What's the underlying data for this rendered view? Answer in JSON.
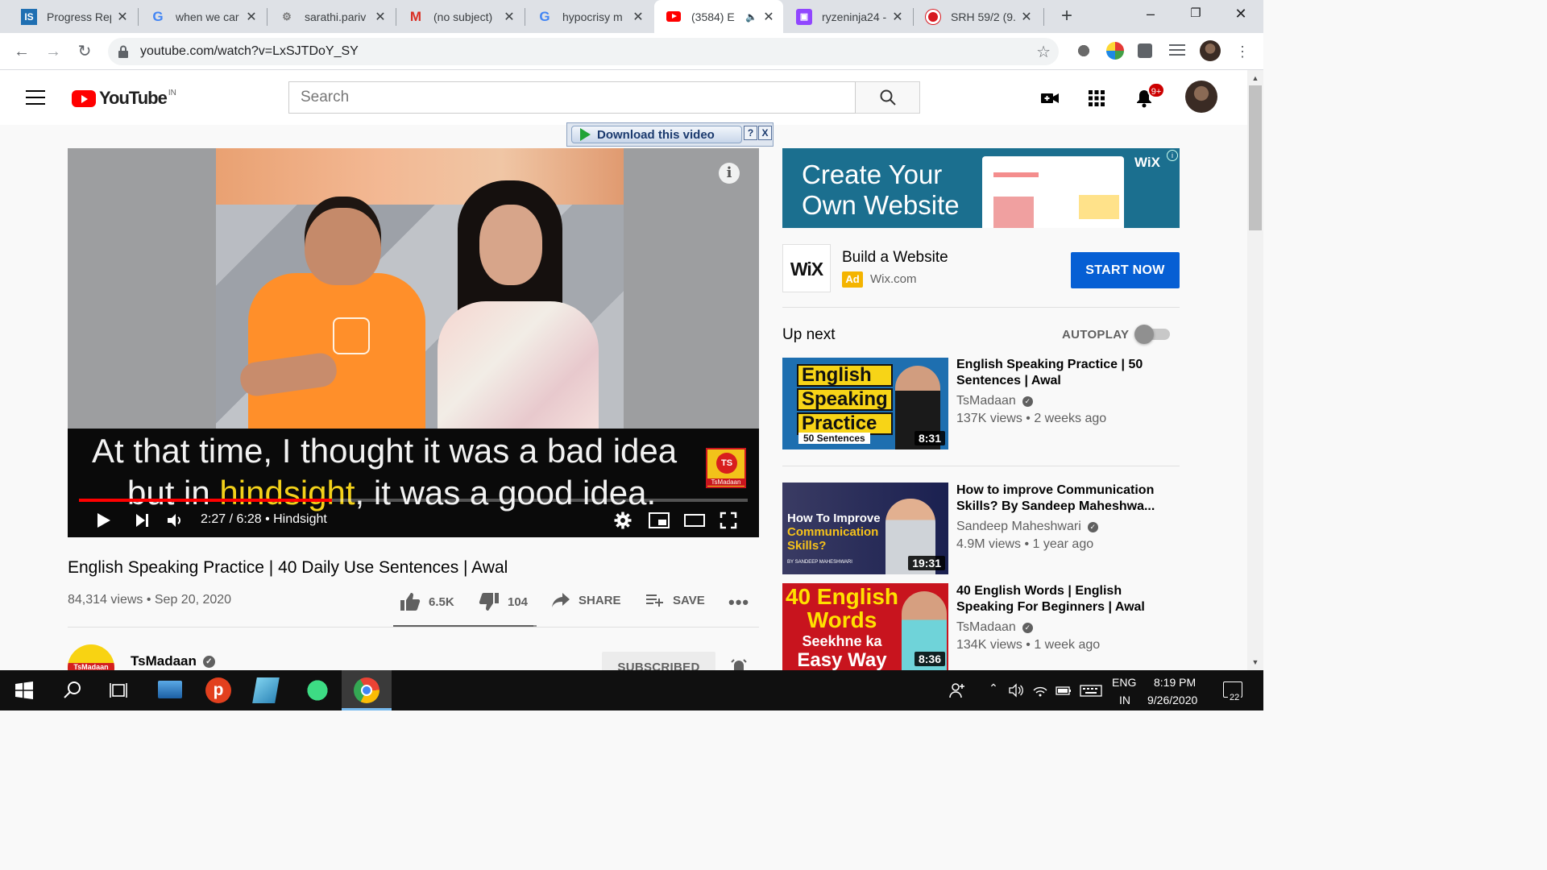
{
  "browser": {
    "tabs": [
      {
        "title": "Progress Rep",
        "icon": "is-icon",
        "active": false
      },
      {
        "title": "when we car",
        "icon": "google-icon",
        "active": false
      },
      {
        "title": "sarathi.pariv",
        "icon": "gear-site-icon",
        "active": false
      },
      {
        "title": "(no subject)",
        "icon": "gmail-icon",
        "active": false
      },
      {
        "title": "hypocrisy m",
        "icon": "google-icon",
        "active": false
      },
      {
        "title": "(3584) E",
        "icon": "youtube-icon",
        "active": true
      },
      {
        "title": "ryzeninja24 -",
        "icon": "twitch-icon",
        "active": false
      },
      {
        "title": "SRH 59/2 (9.",
        "icon": "cricket-icon",
        "active": false
      }
    ],
    "url": "youtube.com/watch?v=LxSJTDoY_SY"
  },
  "youtube": {
    "logo_text": "YouTube",
    "country_code": "IN",
    "search_placeholder": "Search",
    "notification_count": "9+"
  },
  "download_plugin": {
    "label": "Download this video",
    "help": "?",
    "close": "X"
  },
  "player": {
    "caption_line1": "At that time, I thought it was a bad idea",
    "caption_line2_pre": "but in ",
    "caption_line2_highlight": "hindsight",
    "caption_line2_post": ", it was a good idea.",
    "watermark_circle": "TS",
    "watermark_label": "TsMadaan",
    "time_current": "2:27",
    "time_total": "6:28",
    "time_display": "2:27 / 6:28",
    "chapter": "Hindsight",
    "progress_fraction": 0.3789
  },
  "video": {
    "title": "English Speaking Practice | 40 Daily Use Sentences | Awal",
    "views": "84,314 views",
    "date": "Sep 20, 2020",
    "meta": "84,314 views • Sep 20, 2020",
    "likes": "6.5K",
    "dislikes": "104",
    "share_label": "SHARE",
    "save_label": "SAVE",
    "like_ratio": 0.98
  },
  "channel": {
    "name": "TsMadaan",
    "avatar_label": "TsMadaan",
    "subscribe_label": "SUBSCRIBED"
  },
  "ad": {
    "banner_line1": "Create Your",
    "banner_line2": "Own Website",
    "banner_brand": "WiX",
    "logo_text": "WiX",
    "title": "Build a Website",
    "badge": "Ad",
    "domain": "Wix.com",
    "cta": "START NOW"
  },
  "sidebar": {
    "upnext_label": "Up next",
    "autoplay_label": "AUTOPLAY",
    "autoplay_on": false,
    "videos": [
      {
        "title_line1": "English Speaking Practice | 50",
        "title_line2": "Sentences | Awal",
        "channel": "TsMadaan",
        "meta": "137K views • 2 weeks ago",
        "duration": "8:31",
        "thumb_words": [
          "English",
          "Speaking",
          "Practice"
        ],
        "thumb_sub": "50 Sentences"
      },
      {
        "title_line1": "How to improve Communication",
        "title_line2": "Skills? By Sandeep Maheshwa...",
        "channel": "Sandeep Maheshwari",
        "meta": "4.9M views • 1 year ago",
        "duration": "19:31",
        "thumb_line1": "How To Improve",
        "thumb_line2": "Communication",
        "thumb_line3": "Skills?",
        "thumb_small": "BY SANDEEP MAHESHWARI"
      },
      {
        "title_line1": "40 English Words | English",
        "title_line2": "Speaking For Beginners | Awal",
        "channel": "TsMadaan",
        "meta": "134K views • 1 week ago",
        "duration": "8:36",
        "thumb_line1": "40 English",
        "thumb_line2": "Words",
        "thumb_line3": "Seekhne ka",
        "thumb_line4": "Easy Way"
      }
    ]
  },
  "taskbar": {
    "lang_line1": "ENG",
    "lang_line2": "IN",
    "time": "8:19 PM",
    "date": "9/26/2020",
    "notifications": "22"
  },
  "colors": {
    "youtube_red": "#ff0000",
    "cta_blue": "#065fd4",
    "caption_highlight": "#f3d11a"
  }
}
